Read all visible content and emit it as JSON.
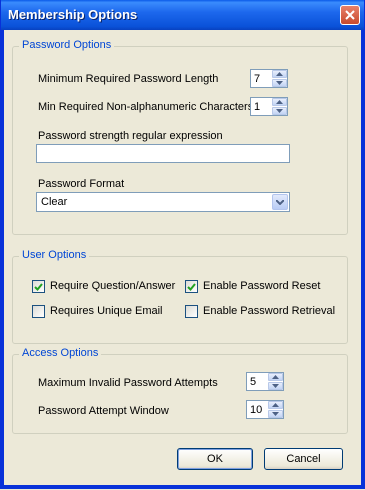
{
  "window": {
    "title": "Membership Options"
  },
  "password_options": {
    "group_title": "Password Options",
    "min_length_label": "Minimum Required Password Length",
    "min_length_value": "7",
    "min_nonalpha_label": "Min Required Non-alphanumeric Characters",
    "min_nonalpha_value": "1",
    "regex_label": "Password strength regular expression",
    "regex_value": "",
    "format_label": "Password Format",
    "format_value": "Clear"
  },
  "user_options": {
    "group_title": "User Options",
    "require_qa": {
      "label": "Require Question/Answer",
      "checked": true
    },
    "enable_reset": {
      "label": "Enable Password Reset",
      "checked": true
    },
    "unique_email": {
      "label": "Requires Unique Email",
      "checked": false
    },
    "enable_retrieval": {
      "label": "Enable Password Retrieval",
      "checked": false
    }
  },
  "access_options": {
    "group_title": "Access Options",
    "max_attempts_label": "Maximum Invalid Password Attempts",
    "max_attempts_value": "5",
    "attempt_window_label": "Password Attempt Window",
    "attempt_window_value": "10"
  },
  "buttons": {
    "ok": "OK",
    "cancel": "Cancel"
  }
}
